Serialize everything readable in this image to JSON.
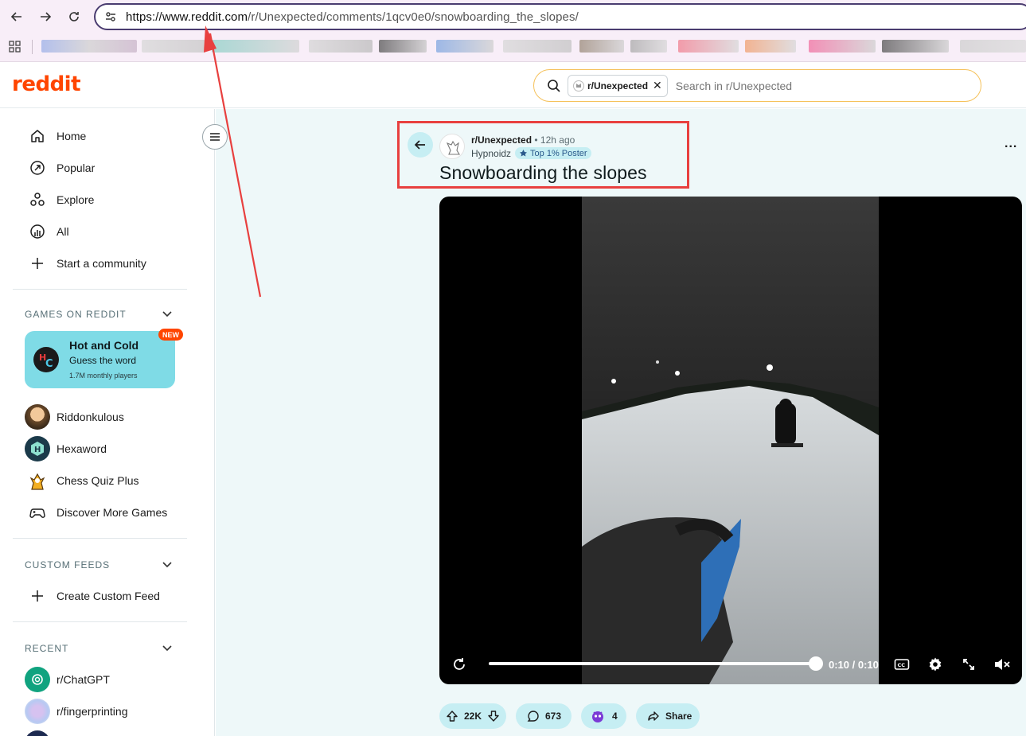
{
  "browser": {
    "url_host": "https://www.reddit.com",
    "url_path": "/r/Unexpected/comments/1qcv0e0/snowboarding_the_slopes/"
  },
  "header": {
    "logo": "reddit",
    "search": {
      "chip_label": "r/Unexpected",
      "chip_close": "✕",
      "placeholder": "Search in r/Unexpected"
    }
  },
  "sidebar": {
    "nav": [
      {
        "label": "Home",
        "icon": "home-icon"
      },
      {
        "label": "Popular",
        "icon": "popular-icon"
      },
      {
        "label": "Explore",
        "icon": "explore-icon"
      },
      {
        "label": "All",
        "icon": "all-icon"
      },
      {
        "label": "Start a community",
        "icon": "plus-icon"
      }
    ],
    "games_section": "GAMES ON REDDIT",
    "featured_game": {
      "title": "Hot and Cold",
      "subtitle": "Guess the word",
      "meta": "1.7M monthly players",
      "badge": "NEW"
    },
    "games": [
      {
        "label": "Riddonkulous"
      },
      {
        "label": "Hexaword"
      },
      {
        "label": "Chess Quiz Plus"
      },
      {
        "label": "Discover More Games"
      }
    ],
    "custom_feeds_section": "CUSTOM FEEDS",
    "create_feed": "Create Custom Feed",
    "recent_section": "RECENT",
    "recent": [
      {
        "label": "r/ChatGPT"
      },
      {
        "label": "r/fingerprinting"
      }
    ]
  },
  "post": {
    "subreddit": "r/Unexpected",
    "separator": "•",
    "time_ago": "12h ago",
    "author": "Hypnoidz",
    "flair": "Top 1% Poster",
    "title": "Snowboarding the slopes",
    "more": "...",
    "video": {
      "time": "0:10 / 0:10",
      "progress": 1.0
    },
    "actions": {
      "votes": "22K",
      "comments": "673",
      "awards": "4",
      "share": "Share"
    }
  },
  "colors": {
    "brand": "#ff4500",
    "main_bg": "#eef8f9",
    "pill_bg": "#c6eef3",
    "game_card": "#7fdbe6",
    "annotation": "#e8403f"
  }
}
